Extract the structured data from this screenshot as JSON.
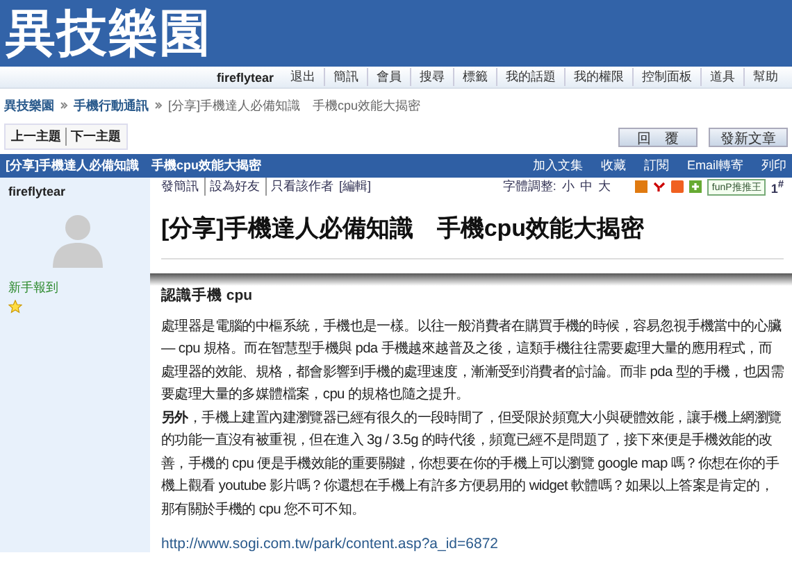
{
  "logo": "異技樂園",
  "nav": {
    "user": "fireflytear",
    "items": [
      "退出",
      "簡訊",
      "會員",
      "搜尋",
      "標籤",
      "我的話題",
      "我的權限",
      "控制面板",
      "道具",
      "幫助"
    ]
  },
  "breadcrumb": [
    "異技樂園",
    "手機行動通訊",
    "[分享]手機達人必備知識　手機cpu效能大揭密"
  ],
  "pager": [
    "上一主題",
    "下一主題"
  ],
  "buttons": [
    "回　覆",
    "發新文章"
  ],
  "thread_bar": {
    "title": "[分享]手機達人必備知識　手機cpu效能大揭密",
    "actions": [
      "加入文集",
      "收藏",
      "訂閱",
      "Email轉寄",
      "列印"
    ]
  },
  "author": {
    "name": "fireflytear",
    "rank": "新手報到"
  },
  "post_tools": {
    "links": [
      "發簡訊",
      "設為好友",
      "只看該作者",
      "[編輯]"
    ],
    "font_label": "字體調整:",
    "font_sizes": [
      "小",
      "中",
      "大"
    ],
    "share": "funP推推王",
    "floor": "1$^{#}$"
  },
  "post": {
    "title": "[分享]手機達人必備知識　手機cpu效能大揭密",
    "heading": "認識手機 cpu",
    "paragraphs": [
      "處理器是電腦的中樞系統，手機也是一樣。以往一般消費者在購買手機的時候，容易忽視手機當中的心臟 — cpu 規格。而在智慧型手機與 pda 手機越來越普及之後，這類手機往往需要處理大量的應用程式，而處理器的效能、規格，都會影響到手機的處理速度，漸漸受到消費者的討論。而非 pda 型的手機，也因需要處理大量的多媒體檔案，cpu 的規格也隨之提升。",
      "**另外**，手機上建置內建瀏覽器已經有很久的一段時間了，但受限於頻寬大小與硬體效能，讓手機上網瀏覽的功能一直沒有被重視，但在進入 3g / 3.5g 的時代後，頻寬已經不是問題了，接下來便是手機效能的改善，手機的 cpu 便是手機效能的重要關鍵，你想要在你的手機上可以瀏覽 google map 嗎？你想在你的手機上觀看 youtube 影片嗎？你還想在手機上有許多方便易用的 widget 軟體嗎？如果以上答案是肯定的，那有關於手機的 cpu 您不可不知。"
    ],
    "link": "http://www.sogi.com.tw/park/content.asp?a_id=6872"
  }
}
